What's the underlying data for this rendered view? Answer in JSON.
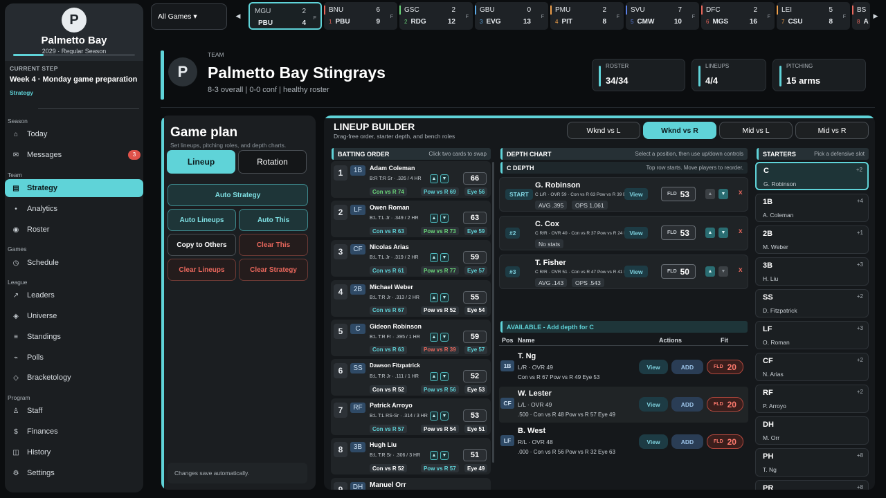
{
  "sidebar": {
    "logo_letter": "P",
    "team_name": "Palmetto Bay",
    "season": "2029  ·  Regular Season",
    "season_progress": 0.25,
    "current_step_label": "CURRENT STEP",
    "current_step": "Week 4 · Monday game preparation",
    "current_step_sub": "Strategy",
    "sections": {
      "season": "Season",
      "team": "Team",
      "games": "Games",
      "league": "League",
      "program": "Program"
    },
    "items": {
      "today": {
        "label": "Today",
        "icon": "⌂"
      },
      "messages": {
        "label": "Messages",
        "icon": "✉",
        "badge": "3"
      },
      "strategy": {
        "label": "Strategy",
        "icon": "▤"
      },
      "analytics": {
        "label": "Analytics",
        "icon": "•"
      },
      "roster": {
        "label": "Roster",
        "icon": "◉"
      },
      "schedule": {
        "label": "Schedule",
        "icon": "◷"
      },
      "leaders": {
        "label": "Leaders",
        "icon": "↗"
      },
      "universe": {
        "label": "Universe",
        "icon": "◈"
      },
      "standings": {
        "label": "Standings",
        "icon": "≡"
      },
      "polls": {
        "label": "Polls",
        "icon": "⌁"
      },
      "bracketology": {
        "label": "Bracketology",
        "icon": "◇"
      },
      "staff": {
        "label": "Staff",
        "icon": "♙"
      },
      "finances": {
        "label": "Finances",
        "icon": "$"
      },
      "history": {
        "label": "History",
        "icon": "◫"
      },
      "settings": {
        "label": "Settings",
        "icon": "⚙"
      }
    }
  },
  "scoreboard": {
    "filter": "All Games ▾",
    "prev_icon": "◀",
    "next_icon": "▶",
    "games": [
      {
        "away": "MGU",
        "away_score": "2",
        "home": "PBU",
        "home_score": "4",
        "home_seed": "",
        "status": "F",
        "accent": "#5fd3d8"
      },
      {
        "away": "BNU",
        "away_score": "6",
        "home": "PBU",
        "home_score": "9",
        "home_seed": "1",
        "status": "F",
        "accent": "#e8675c"
      },
      {
        "away": "GSC",
        "away_score": "2",
        "home": "RDG",
        "home_score": "12",
        "home_seed": "2",
        "status": "F",
        "accent": "#6bd67a"
      },
      {
        "away": "GBU",
        "away_score": "0",
        "home": "EVG",
        "home_score": "13",
        "home_seed": "3",
        "status": "F",
        "accent": "#5aa9e6"
      },
      {
        "away": "PMU",
        "away_score": "2",
        "home": "PIT",
        "home_score": "8",
        "home_seed": "4",
        "status": "F",
        "accent": "#f0a04b"
      },
      {
        "away": "SVU",
        "away_score": "7",
        "home": "CMW",
        "home_score": "10",
        "home_seed": "5",
        "status": "F",
        "accent": "#5a7fe6"
      },
      {
        "away": "DFC",
        "away_score": "2",
        "home": "MGS",
        "home_score": "16",
        "home_seed": "6",
        "status": "F",
        "accent": "#e8675c"
      },
      {
        "away": "LEI",
        "away_score": "5",
        "home": "CSU",
        "home_score": "8",
        "home_seed": "7",
        "status": "F",
        "accent": "#f0a04b"
      },
      {
        "away": "BS",
        "away_score": "",
        "home": "A",
        "home_score": "",
        "home_seed": "8",
        "status": "",
        "accent": "#e8675c"
      }
    ]
  },
  "header": {
    "logo_letter": "P",
    "eyebrow": "TEAM",
    "title": "Palmetto Bay Stingrays",
    "subtitle": "8-3 overall | 0-0 conf | healthy roster",
    "stats": [
      {
        "label": "ROSTER",
        "value": "34/34"
      },
      {
        "label": "LINEUPS",
        "value": "4/4"
      },
      {
        "label": "PITCHING",
        "value": "15 arms"
      }
    ]
  },
  "game_plan": {
    "title": "Game plan",
    "subtitle": "Set lineups, pitching roles, and depth charts.",
    "tabs": [
      "Lineup",
      "Rotation"
    ],
    "buttons": {
      "auto_strategy": "Auto Strategy",
      "auto_lineups": "Auto Lineups",
      "auto_this": "Auto This",
      "copy_to_others": "Copy to Others",
      "clear_this": "Clear This",
      "clear_lineups": "Clear Lineups",
      "clear_strategy": "Clear Strategy"
    },
    "note": "Changes save automatically."
  },
  "lineup": {
    "title": "LINEUP BUILDER",
    "subtitle": "Drag-free order, starter depth, and bench roles",
    "splits": [
      "Wknd vs L",
      "Wknd vs R",
      "Mid vs L",
      "Mid vs R"
    ],
    "batting_header": "BATTING ORDER",
    "batting_hint": "Click two cards to swap",
    "depth_header": "DEPTH CHART",
    "depth_hint": "Select a position, then use up/down controls",
    "starters_header": "STARTERS",
    "starters_hint": "Pick a defensive slot",
    "batting": [
      {
        "n": "1",
        "pos": "1B",
        "name": "Adam Coleman",
        "line": "B:R T:R Sr · .326 / 4 HR",
        "ovr": "66",
        "con": "Con vs R 74",
        "pow": "Pow vs R 69",
        "eye": "Eye 56",
        "con_c": "c-green",
        "pow_c": "c-teal",
        "eye_c": "c-teal"
      },
      {
        "n": "2",
        "pos": "LF",
        "name": "Owen Roman",
        "line": "B:L T:L Jr · .349 / 2 HR",
        "ovr": "63",
        "con": "Con vs R 63",
        "pow": "Pow vs R 73",
        "eye": "Eye 59",
        "con_c": "c-teal",
        "pow_c": "c-green",
        "eye_c": "c-teal"
      },
      {
        "n": "3",
        "pos": "CF",
        "name": "Nicolas Arias",
        "line": "B:L T:L Jr · .319 / 2 HR",
        "ovr": "59",
        "con": "Con vs R 61",
        "pow": "Pow vs R 77",
        "eye": "Eye 57",
        "con_c": "c-teal",
        "pow_c": "c-green",
        "eye_c": "c-teal"
      },
      {
        "n": "4",
        "pos": "2B",
        "name": "Michael Weber",
        "line": "B:L T:R Jr · .313 / 2 HR",
        "ovr": "55",
        "con": "Con vs R 67",
        "pow": "Pow vs R 52",
        "eye": "Eye 54",
        "con_c": "c-teal",
        "pow_c": "c-white",
        "eye_c": "c-white"
      },
      {
        "n": "5",
        "pos": "C",
        "name": "Gideon Robinson",
        "line": "B:L T:R Fr · .395 / 1 HR",
        "ovr": "59",
        "con": "Con vs R 63",
        "pow": "Pow vs R 39",
        "eye": "Eye 57",
        "con_c": "c-teal",
        "pow_c": "c-red",
        "eye_c": "c-teal"
      },
      {
        "n": "6",
        "pos": "SS",
        "name": "Dawson Fitzpatrick",
        "line": "B:L T:R Jr · .111 / 1 HR",
        "ovr": "52",
        "con": "Con vs R 52",
        "pow": "Pow vs R 56",
        "eye": "Eye 53",
        "con_c": "c-white",
        "pow_c": "c-teal",
        "eye_c": "c-white"
      },
      {
        "n": "7",
        "pos": "RF",
        "name": "Patrick Arroyo",
        "line": "B:L T:L RS-Sr · .314 / 3 HR",
        "ovr": "53",
        "con": "Con vs R 57",
        "pow": "Pow vs R 54",
        "eye": "Eye 51",
        "con_c": "c-teal",
        "pow_c": "c-white",
        "eye_c": "c-white"
      },
      {
        "n": "8",
        "pos": "3B",
        "name": "Hugh Liu",
        "line": "B:L T:R Sr · .306 / 3 HR",
        "ovr": "51",
        "con": "Con vs R 52",
        "pow": "Pow vs R 57",
        "eye": "Eye 49",
        "con_c": "c-white",
        "pow_c": "c-teal",
        "eye_c": "c-white"
      },
      {
        "n": "9",
        "pos": "DH",
        "name": "Manuel Orr",
        "line": "",
        "ovr": "",
        "con": "",
        "pow": "",
        "eye": "",
        "con_c": "c-white",
        "pow_c": "c-white",
        "eye_c": "c-white"
      }
    ],
    "depth_title": "C DEPTH",
    "depth_hint2": "Top row starts. Move players to reorder.",
    "depth": [
      {
        "role": "START",
        "name": "G. Robinson",
        "line": "C L/R · OVR 59 · Con vs R 63  Pow vs R 39  Eye 57",
        "s1": "AVG .395",
        "s2": "OPS 1.061",
        "fld_label": "FLD",
        "fld": "53",
        "up": false,
        "down": true
      },
      {
        "role": "#2",
        "name": "C. Cox",
        "line": "C R/R · OVR 40 · Con vs R 37  Pow vs R 24  Eye 39",
        "s1": "No stats",
        "s2": "",
        "fld_label": "FLD",
        "fld": "53",
        "up": true,
        "down": true
      },
      {
        "role": "#3",
        "name": "T. Fisher",
        "line": "C R/R · OVR 51 · Con vs R 47  Pow vs R 41  Eye 44",
        "s1": "AVG .143",
        "s2": "OPS .543",
        "fld_label": "FLD",
        "fld": "50",
        "up": true,
        "down": false
      }
    ],
    "view_label": "View",
    "remove_icon": "x",
    "up_icon": "▲",
    "down_icon": "▼",
    "available_header": "AVAILABLE - Add depth for C",
    "available_cols": {
      "pos": "Pos",
      "name": "Name",
      "actions": "Actions",
      "fit": "Fit"
    },
    "add_label": "ADD",
    "available": [
      {
        "pos": "1B",
        "name": "T. Ng",
        "line": "L/R · OVR 49",
        "line2": "Con vs R 67  Pow vs R 49  Eye 53",
        "fld_label": "FLD",
        "fit": "20"
      },
      {
        "pos": "CF",
        "name": "W. Lester",
        "line": "L/L · OVR 49",
        "line2": ".500 · Con vs R 48  Pow vs R 57  Eye 49",
        "fld_label": "FLD",
        "fit": "20"
      },
      {
        "pos": "LF",
        "name": "B. West",
        "line": "R/L · OVR 48",
        "line2": ".000 · Con vs R 56  Pow vs R 32  Eye 63",
        "fld_label": "FLD",
        "fit": "20"
      }
    ],
    "starters": [
      {
        "pos": "C",
        "name": "G. Robinson",
        "delta": "+2"
      },
      {
        "pos": "1B",
        "name": "A. Coleman",
        "delta": "+4"
      },
      {
        "pos": "2B",
        "name": "M. Weber",
        "delta": "+1"
      },
      {
        "pos": "3B",
        "name": "H. Liu",
        "delta": "+3"
      },
      {
        "pos": "SS",
        "name": "D. Fitzpatrick",
        "delta": "+2"
      },
      {
        "pos": "LF",
        "name": "O. Roman",
        "delta": "+3"
      },
      {
        "pos": "CF",
        "name": "N. Arias",
        "delta": "+2"
      },
      {
        "pos": "RF",
        "name": "P. Arroyo",
        "delta": "+2"
      },
      {
        "pos": "DH",
        "name": "M. Orr",
        "delta": ""
      },
      {
        "pos": "PH",
        "name": "T. Ng",
        "delta": "+8"
      },
      {
        "pos": "PR",
        "name": "",
        "delta": "+8"
      }
    ]
  }
}
